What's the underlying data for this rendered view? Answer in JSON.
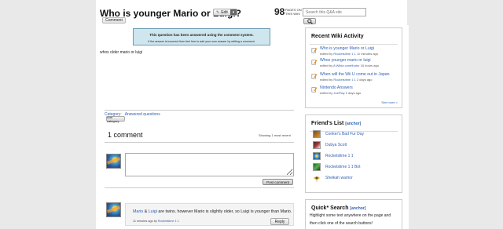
{
  "question": {
    "title": "Who is younger Mario or Luigi?",
    "edit_label": "Edit",
    "comment_label": "Comment",
    "page_views": "98",
    "page_views_label_1": "PAGES ON",
    "page_views_label_2": "THIS WIKI",
    "notice_line1": "This question has been answered using the comment system.",
    "notice_line2": "If the answer is incorrect then feel free to add your own answer by editing a comment.",
    "body": "whos older mario or luigi",
    "category_label": "Category:",
    "category_value": "Answered questions",
    "add_category": "Add category"
  },
  "search": {
    "placeholder": "Search this Q&A site"
  },
  "comments": {
    "count_label": "1 comment",
    "showing": "Showing 1 most recent",
    "post_label": "Post comment",
    "reply_label": "Reply",
    "items": [
      {
        "name1": "Mario",
        "amp": " & ",
        "name2": "Luigi",
        "text": " are twins. however Mario is slightly older, so Luigi is younger than Mario.",
        "meta": "11 minutes ago by ",
        "author": "Rocketslime 1 1"
      }
    ]
  },
  "recent": {
    "title": "Recent Wiki Activity",
    "items": [
      {
        "title": "Who is younger Mario or Luigi",
        "meta_pre": "edited by ",
        "user": "Rocketslime 1 1",
        "meta_post": " 11 minutes ago"
      },
      {
        "title": "Whos younger mario or luigi",
        "meta_pre": "edited by ",
        "user": "A Wikia contributor",
        "meta_post": " 16 hours ago"
      },
      {
        "title": "When will the Wii U come out in Japan",
        "meta_pre": "edited by ",
        "user": "Rocketslime 1 1",
        "meta_post": " 2 days ago"
      },
      {
        "title": "Nintendo Answers",
        "meta_pre": "edited by ",
        "user": "JoePlay",
        "meta_post": " 2 days ago"
      }
    ],
    "see_more": "See more >"
  },
  "friends": {
    "title": "Friend's List",
    "anchor": "[anchor]",
    "items": [
      {
        "name": "Conker's Bad Fur Day"
      },
      {
        "name": "Dubya Scott"
      },
      {
        "name": "Rocketslime 1 1"
      },
      {
        "name": "Rocketslime 1 1 Bot"
      },
      {
        "name": "Sheikah warrior"
      }
    ]
  },
  "quick_search": {
    "title": "Quick* Search",
    "anchor": "[anchor]",
    "line1": "Highlight some text anywhere on the page and",
    "line2": "then click one of the search buttons!"
  },
  "colors": {
    "link": "#2f5fb0",
    "notice_bg": "#cfe6ee",
    "activity_icon": "#e38a1a"
  }
}
